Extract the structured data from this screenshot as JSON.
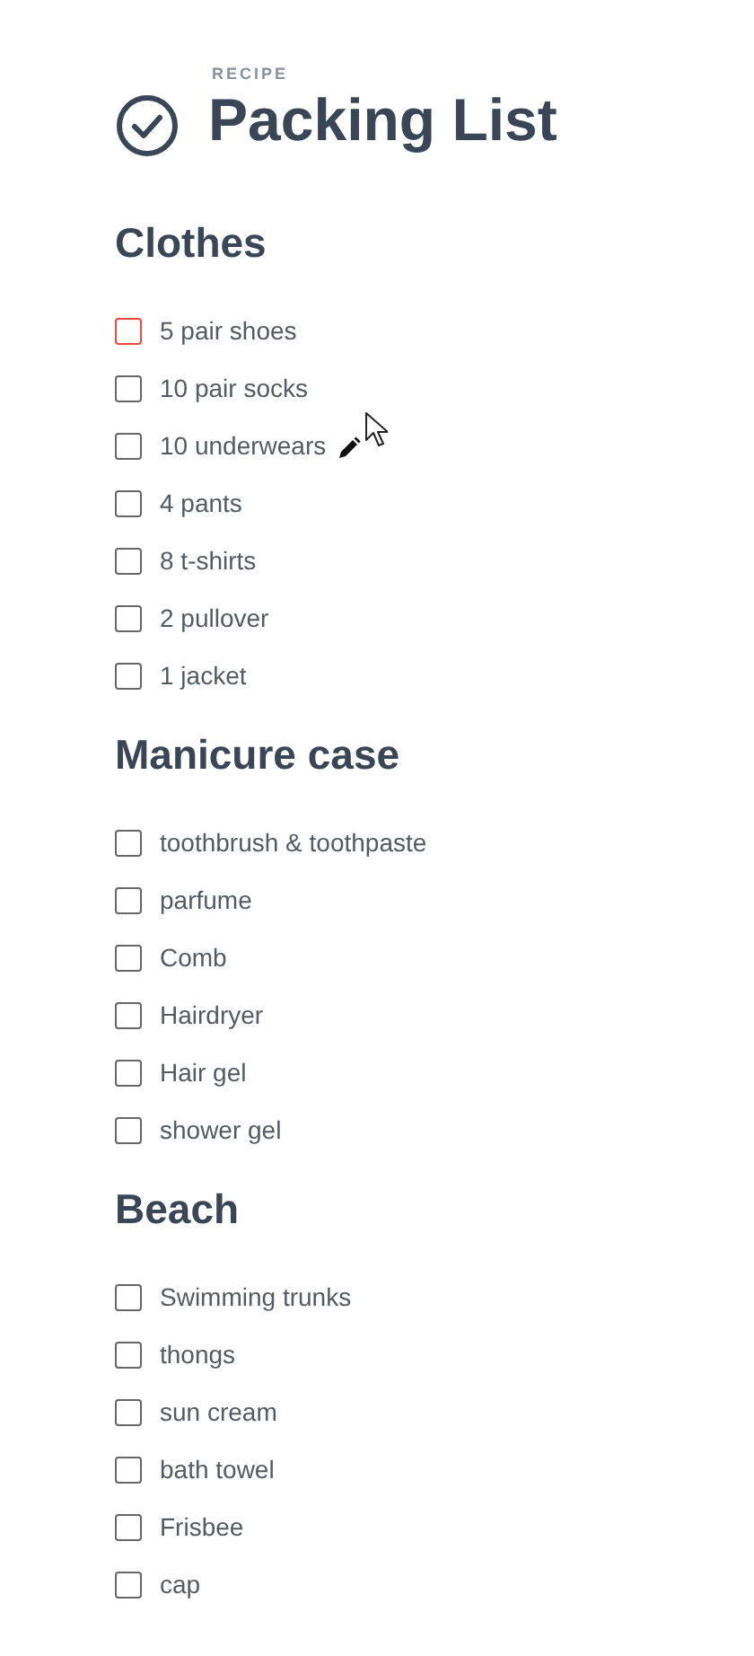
{
  "header": {
    "eyebrow": "RECIPE",
    "title": "Packing List"
  },
  "sections": [
    {
      "title": "Clothes",
      "items": [
        {
          "label": "5 pair shoes",
          "checked": false,
          "color": "#f04a3a",
          "hovered": false
        },
        {
          "label": "10 pair socks",
          "checked": false,
          "color": "#666666",
          "hovered": false
        },
        {
          "label": "10 underwears",
          "checked": false,
          "color": "#666666",
          "hovered": true
        },
        {
          "label": "4 pants",
          "checked": false,
          "color": "#666666",
          "hovered": false
        },
        {
          "label": "8 t-shirts",
          "checked": false,
          "color": "#666666",
          "hovered": false
        },
        {
          "label": "2 pullover",
          "checked": false,
          "color": "#666666",
          "hovered": false
        },
        {
          "label": "1 jacket",
          "checked": false,
          "color": "#666666",
          "hovered": false
        }
      ]
    },
    {
      "title": "Manicure case",
      "items": [
        {
          "label": "toothbrush & toothpaste",
          "checked": false,
          "color": "#666666",
          "hovered": false
        },
        {
          "label": "parfume",
          "checked": false,
          "color": "#666666",
          "hovered": false
        },
        {
          "label": "Comb",
          "checked": false,
          "color": "#666666",
          "hovered": false
        },
        {
          "label": "Hairdryer",
          "checked": false,
          "color": "#666666",
          "hovered": false
        },
        {
          "label": "Hair gel",
          "checked": false,
          "color": "#666666",
          "hovered": false
        },
        {
          "label": "shower gel",
          "checked": false,
          "color": "#666666",
          "hovered": false
        }
      ]
    },
    {
      "title": "Beach",
      "items": [
        {
          "label": "Swimming trunks",
          "checked": false,
          "color": "#666666",
          "hovered": false
        },
        {
          "label": "thongs",
          "checked": false,
          "color": "#666666",
          "hovered": false
        },
        {
          "label": "sun cream",
          "checked": false,
          "color": "#666666",
          "hovered": false
        },
        {
          "label": "bath towel",
          "checked": false,
          "color": "#666666",
          "hovered": false
        },
        {
          "label": "Frisbee",
          "checked": false,
          "color": "#666666",
          "hovered": false
        },
        {
          "label": "cap",
          "checked": false,
          "color": "#666666",
          "hovered": false
        }
      ]
    }
  ]
}
